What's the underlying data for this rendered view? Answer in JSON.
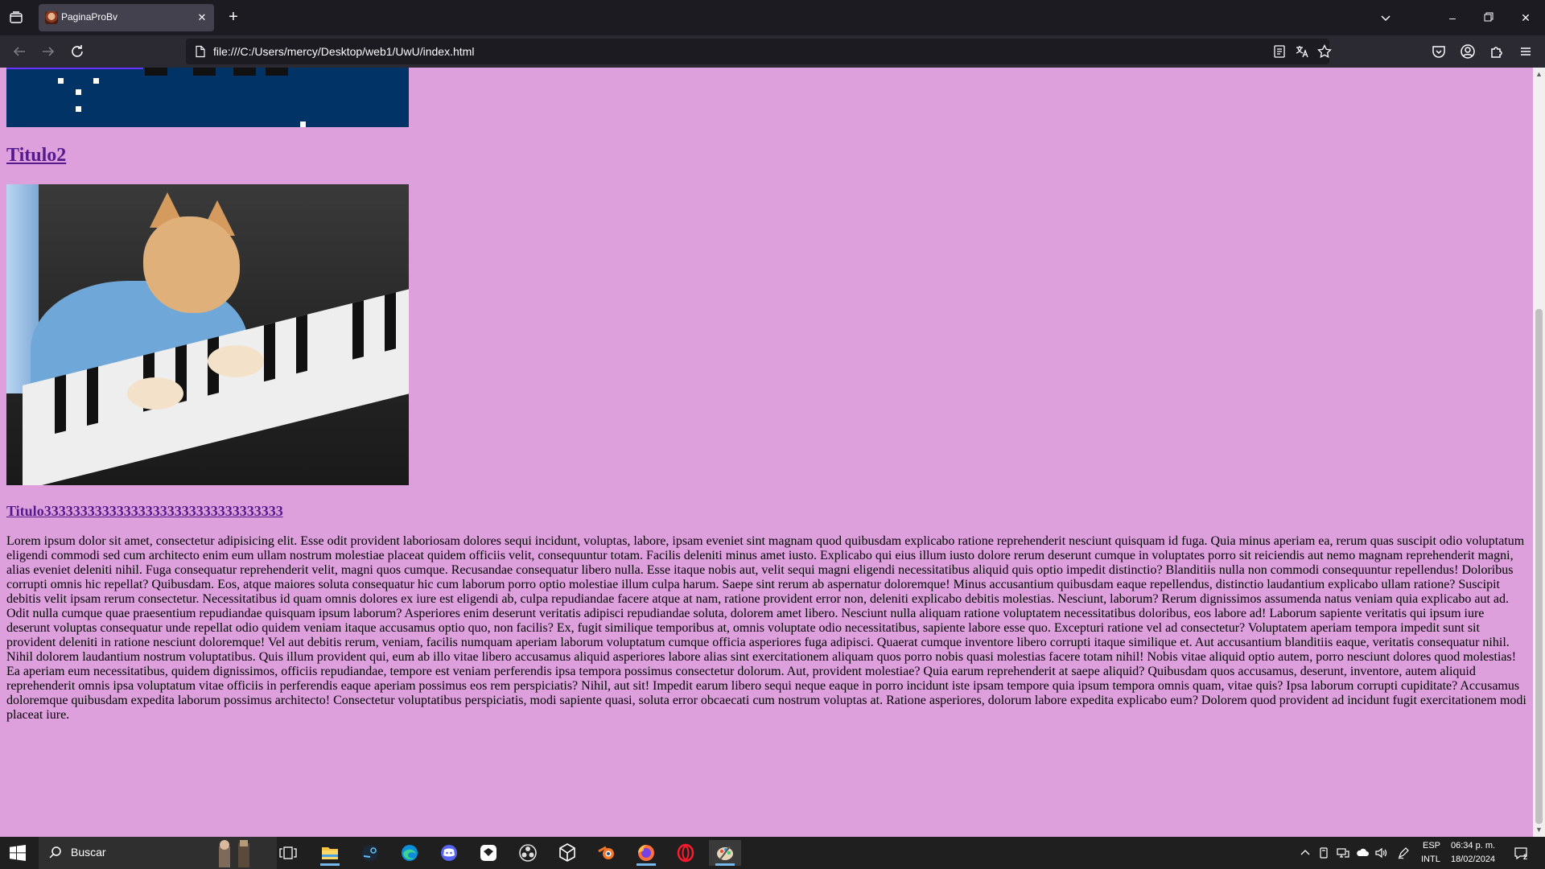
{
  "browser": {
    "tab": {
      "title": "PaginaProBv"
    },
    "url": "file:///C:/Users/mercy/Desktop/web1/UwU/index.html"
  },
  "page": {
    "title2": "Titulo2",
    "title3": "Titulo333333333333333333333333333333333",
    "paragraph": "Lorem ipsum dolor sit amet, consectetur adipisicing elit. Esse odit provident laboriosam dolores sequi incidunt, voluptas, labore, ipsam eveniet sint magnam quod quibusdam explicabo ratione reprehenderit nesciunt quisquam id fuga. Quia minus aperiam ea, rerum quas suscipit odio voluptatum eligendi commodi sed cum architecto enim eum ullam nostrum molestiae placeat quidem officiis velit, consequuntur totam. Facilis deleniti minus amet iusto. Explicabo qui eius illum iusto dolore rerum deserunt cumque in voluptates porro sit reiciendis aut nemo magnam reprehenderit magni, alias eveniet deleniti nihil. Fuga consequatur reprehenderit velit, magni quos cumque. Recusandae consequatur libero nulla. Esse itaque nobis aut, velit sequi magni eligendi necessitatibus aliquid quis optio impedit distinctio? Blanditiis nulla non commodi consequuntur repellendus! Doloribus corrupti omnis hic repellat? Quibusdam. Eos, atque maiores soluta consequatur hic cum laborum porro optio molestiae illum culpa harum. Saepe sint rerum ab aspernatur doloremque! Minus accusantium quibusdam eaque repellendus, distinctio laudantium explicabo ullam ratione? Suscipit debitis velit ipsam rerum consectetur. Necessitatibus id quam omnis dolores ex iure est eligendi ab, culpa repudiandae facere atque at nam, ratione provident error non, deleniti explicabo debitis molestias. Nesciunt, laborum? Rerum dignissimos assumenda natus veniam quia explicabo aut ad. Odit nulla cumque quae praesentium repudiandae quisquam ipsum laborum? Asperiores enim deserunt veritatis adipisci repudiandae soluta, dolorem amet libero. Nesciunt nulla aliquam ratione voluptatem necessitatibus doloribus, eos labore ad! Laborum sapiente veritatis qui ipsum iure deserunt voluptas consequatur unde repellat odio quidem veniam itaque accusamus optio quo, non facilis? Ex, fugit similique temporibus at, omnis voluptate odio necessitatibus, sapiente labore esse quo. Excepturi ratione vel ad consectetur? Voluptatem aperiam tempora impedit sunt sit provident deleniti in ratione nesciunt doloremque! Vel aut debitis rerum, veniam, facilis numquam aperiam laborum voluptatum cumque officia asperiores fuga adipisci. Quaerat cumque inventore libero corrupti itaque similique et. Aut accusantium blanditiis eaque, veritatis consequatur nihil. Nihil dolorem laudantium nostrum voluptatibus. Quis illum provident qui, eum ab illo vitae libero accusamus aliquid asperiores labore alias sint exercitationem aliquam quos porro nobis quasi molestias facere totam nihil! Nobis vitae aliquid optio autem, porro nesciunt dolores quod molestias! Ea aperiam eum necessitatibus, quidem dignissimos, officiis repudiandae, tempore est veniam perferendis ipsa tempora possimus consectetur dolorum. Aut, provident molestiae? Quia earum reprehenderit at saepe aliquid? Quibusdam quos accusamus, deserunt, inventore, autem aliquid reprehenderit omnis ipsa voluptatum vitae officiis in perferendis eaque aperiam possimus eos rem perspiciatis? Nihil, aut sit! Impedit earum libero sequi neque eaque in porro incidunt iste ipsam tempore quia ipsum tempora omnis quam, vitae quis? Ipsa laborum corrupti cupiditate? Accusamus doloremque quibusdam expedita laborum possimus architecto! Consectetur voluptatibus perspiciatis, modi sapiente quasi, soluta error obcaecati cum nostrum voluptas at. Ratione asperiores, dolorum labore expedita explicabo eum? Dolorem quod provident ad incidunt fugit exercitationem modi placeat iure."
  },
  "taskbar": {
    "search_placeholder": "Buscar",
    "lang_top": "ESP",
    "lang_bottom": "INTL",
    "time": "06:34 p. m.",
    "date": "18/02/2024",
    "notification_count": "2"
  },
  "colors": {
    "page_background": "#dda0dd",
    "link": "#551a8b",
    "browser_chrome": "#1c1b22",
    "toolbar": "#2b2a33"
  }
}
